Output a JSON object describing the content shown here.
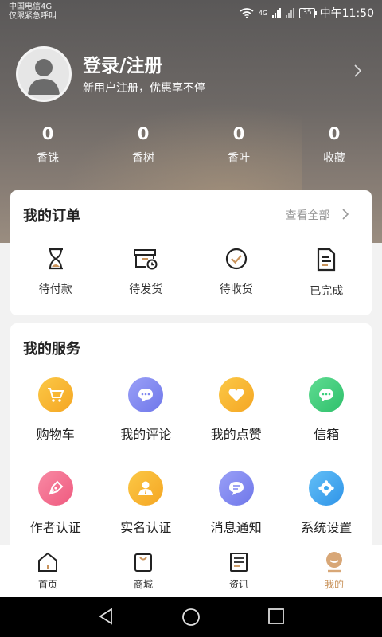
{
  "status_bar": {
    "carrier": "中国电信4G",
    "emergency": "仅限紧急呼叫",
    "battery": "35",
    "time": "中午11:50",
    "network": "4G"
  },
  "profile": {
    "title": "登录/注册",
    "subtitle": "新用户注册，优惠享不停"
  },
  "stats": [
    {
      "value": "0",
      "label": "香铢"
    },
    {
      "value": "0",
      "label": "香树"
    },
    {
      "value": "0",
      "label": "香叶"
    },
    {
      "value": "0",
      "label": "收藏"
    }
  ],
  "orders": {
    "title": "我的订单",
    "view_all": "查看全部",
    "items": [
      {
        "label": "待付款",
        "icon": "hourglass-icon"
      },
      {
        "label": "待发货",
        "icon": "box-clock-icon"
      },
      {
        "label": "待收货",
        "icon": "check-circle-icon"
      },
      {
        "label": "已完成",
        "icon": "document-icon"
      }
    ]
  },
  "services": {
    "title": "我的服务",
    "items": [
      {
        "label": "购物车",
        "icon": "cart-icon",
        "color": "#f7b733"
      },
      {
        "label": "我的评论",
        "icon": "comment-icon",
        "color": "#7f86f0"
      },
      {
        "label": "我的点赞",
        "icon": "heart-icon",
        "color": "#f8b63a"
      },
      {
        "label": "信箱",
        "icon": "mail-chat-icon",
        "color": "#3ccf7c"
      },
      {
        "label": "作者认证",
        "icon": "pen-icon",
        "color": "#f3678a"
      },
      {
        "label": "实名认证",
        "icon": "person-icon",
        "color": "#f8b63a"
      },
      {
        "label": "消息通知",
        "icon": "message-icon",
        "color": "#7f86f0"
      },
      {
        "label": "系统设置",
        "icon": "settings-icon",
        "color": "#3ea8f0"
      }
    ]
  },
  "tabs": [
    {
      "label": "首页",
      "icon": "home-icon",
      "active": false
    },
    {
      "label": "商城",
      "icon": "shop-bag-icon",
      "active": false
    },
    {
      "label": "资讯",
      "icon": "news-icon",
      "active": false
    },
    {
      "label": "我的",
      "icon": "profile-face-icon",
      "active": true
    }
  ],
  "colors": {
    "accent": "#c9935b",
    "tab_inactive": "#333333"
  }
}
